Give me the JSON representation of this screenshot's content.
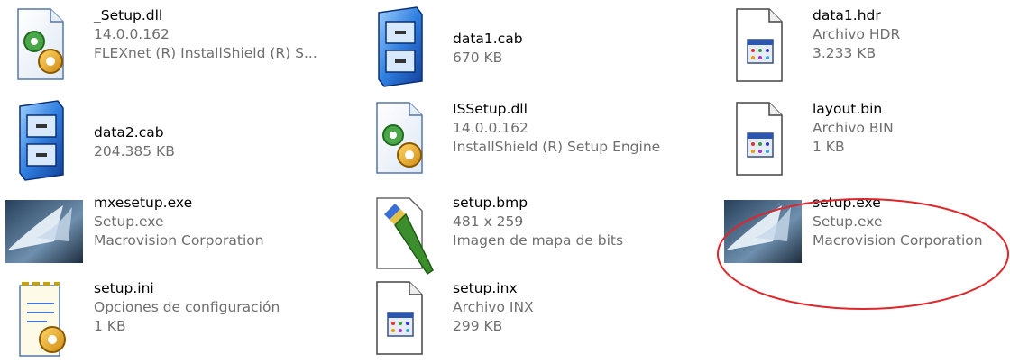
{
  "colors": {
    "name_text": "#000000",
    "meta_text": "#6f6f6f",
    "highlight": "#e0262b",
    "background": "#ffffff"
  },
  "files": [
    {
      "name": "_Setup.dll",
      "line2": "14.0.0.162",
      "line3": "FLEXnet (R) InstallShield (R) S...",
      "icon": "dll-gear-icon"
    },
    {
      "name": "data1.cab",
      "line2": "670 KB",
      "line3": "",
      "icon": "cabinet-icon"
    },
    {
      "name": "data1.hdr",
      "line2": "Archivo HDR",
      "line3": "3.233 KB",
      "icon": "generic-file-icon"
    },
    {
      "name": "data2.cab",
      "line2": "204.385 KB",
      "line3": "",
      "icon": "cabinet-icon"
    },
    {
      "name": "ISSetup.dll",
      "line2": "14.0.0.162",
      "line3": "InstallShield (R) Setup Engine",
      "icon": "dll-gear-icon"
    },
    {
      "name": "layout.bin",
      "line2": "Archivo BIN",
      "line3": "1 KB",
      "icon": "generic-file-icon"
    },
    {
      "name": "mxesetup.exe",
      "line2": "Setup.exe",
      "line3": "Macrovision Corporation",
      "icon": "macrovision-setup-icon"
    },
    {
      "name": "setup.bmp",
      "line2": "481 x 259",
      "line3": "Imagen de mapa de bits",
      "icon": "paint-brush-icon"
    },
    {
      "name": "setup.exe",
      "line2": "Setup.exe",
      "line3": "Macrovision Corporation",
      "icon": "macrovision-setup-icon"
    },
    {
      "name": "setup.ini",
      "line2": "Opciones de configuración",
      "line3": "1 KB",
      "icon": "ini-config-icon"
    },
    {
      "name": "setup.inx",
      "line2": "Archivo INX",
      "line3": "299 KB",
      "icon": "generic-file-icon"
    }
  ],
  "annotation": {
    "highlighted_file": "setup.exe",
    "shape": "red-ellipse"
  }
}
